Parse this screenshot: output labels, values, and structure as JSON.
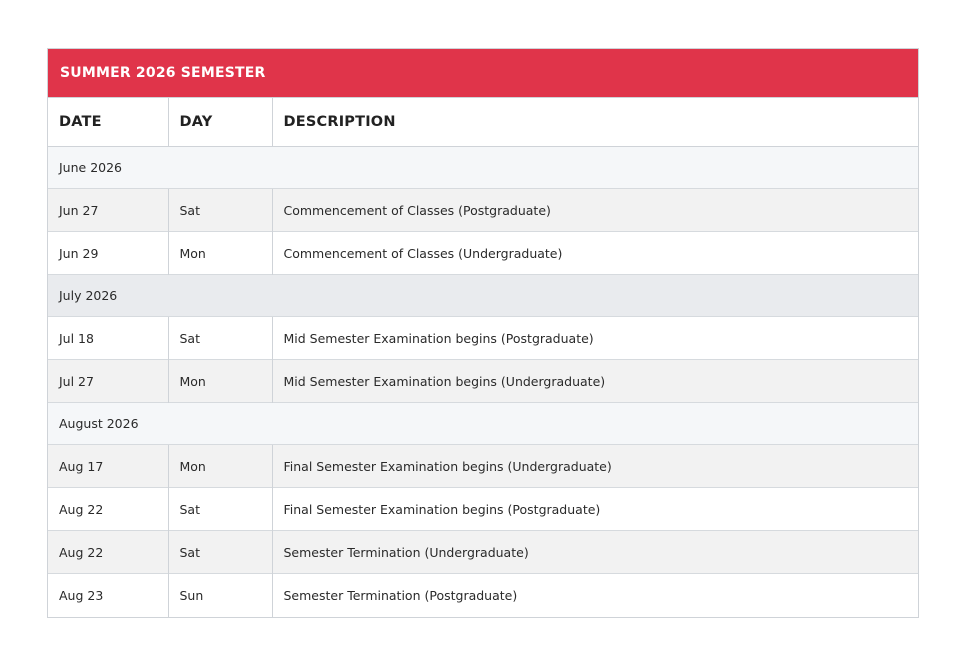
{
  "calendar": {
    "title": "SUMMER 2026 SEMESTER",
    "headers": {
      "date": "DATE",
      "day": "DAY",
      "description": "DESCRIPTION"
    },
    "months": [
      {
        "label": "June 2026",
        "events": [
          {
            "date": "Jun 27",
            "day": "Sat",
            "description": "Commencement of Classes (Postgraduate)"
          },
          {
            "date": "Jun 29",
            "day": "Mon",
            "description": "Commencement of Classes (Undergraduate)"
          }
        ]
      },
      {
        "label": "July 2026",
        "events": [
          {
            "date": "Jul 18",
            "day": "Sat",
            "description": "Mid Semester Examination begins (Postgraduate)"
          },
          {
            "date": "Jul 27",
            "day": "Mon",
            "description": "Mid Semester Examination begins (Undergraduate)"
          }
        ]
      },
      {
        "label": "August 2026",
        "events": [
          {
            "date": "Aug 17",
            "day": "Mon",
            "description": "Final Semester Examination begins (Undergraduate)"
          },
          {
            "date": "Aug 22",
            "day": "Sat",
            "description": "Final Semester Examination begins (Postgraduate)"
          },
          {
            "date": "Aug 22",
            "day": "Sat",
            "description": "Semester Termination (Undergraduate)"
          },
          {
            "date": "Aug 23",
            "day": "Sun",
            "description": "Semester Termination (Postgraduate)"
          }
        ]
      }
    ]
  },
  "colors": {
    "accent": "#e0344a"
  }
}
